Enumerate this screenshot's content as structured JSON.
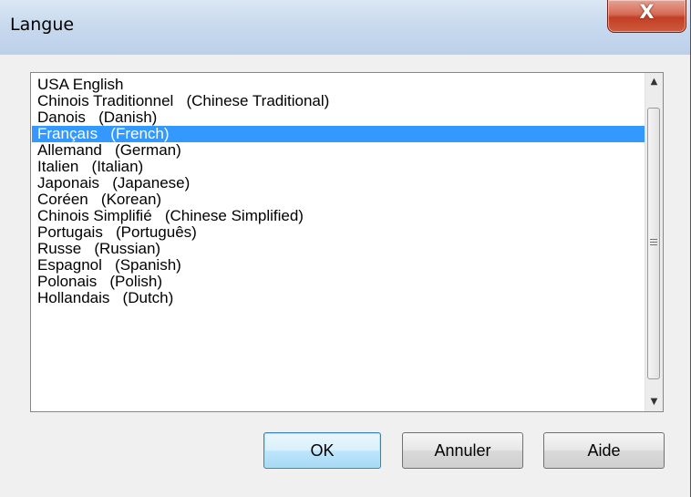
{
  "window": {
    "title": "Langue",
    "close_glyph": "X"
  },
  "languages": [
    "USA English",
    "Chinois Traditionnel   (Chinese Traditional)",
    "Danois   (Danish)",
    "Françaıs   (French)",
    "Allemand   (German)",
    "Italien   (Italian)",
    "Japonais   (Japanese)",
    "Coréen   (Korean)",
    "Chinois Simplifié   (Chinese Simplified)",
    "Portugais   (Português)",
    "Russe   (Russian)",
    "Espagnol   (Spanish)",
    "Polonais   (Polish)",
    "Hollandais   (Dutch)"
  ],
  "selected_index": 3,
  "scrollbar": {
    "up_glyph": "▲",
    "down_glyph": "▼"
  },
  "buttons": {
    "ok_label": "OK",
    "cancel_label": "Annuler",
    "help_label": "Aide"
  },
  "colors": {
    "selection": "#3399ff",
    "title_bar": "#c9daee",
    "close_button": "#c23f26"
  }
}
